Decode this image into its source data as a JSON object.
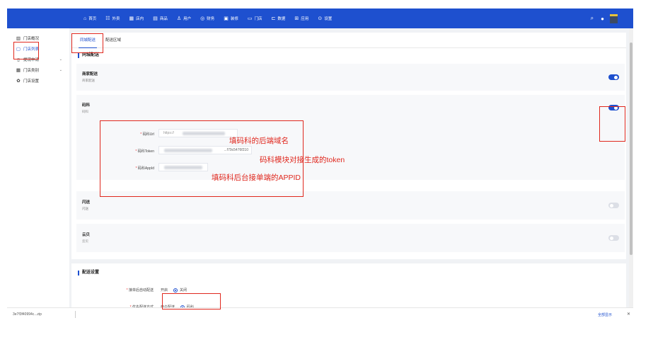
{
  "topnav": {
    "items": [
      {
        "icon": "home-icon",
        "glyph": "⌂",
        "label": "首页"
      },
      {
        "icon": "takeout-icon",
        "glyph": "☷",
        "label": "外卖"
      },
      {
        "icon": "dine-in-icon",
        "glyph": "▦",
        "label": "店内"
      },
      {
        "icon": "goods-icon",
        "glyph": "▤",
        "label": "商品"
      },
      {
        "icon": "user-icon",
        "glyph": "♙",
        "label": "用户"
      },
      {
        "icon": "finance-icon",
        "glyph": "◎",
        "label": "财务"
      },
      {
        "icon": "decorate-icon",
        "glyph": "▣",
        "label": "装修"
      },
      {
        "icon": "store-icon",
        "glyph": "▭",
        "label": "门店"
      },
      {
        "icon": "data-icon",
        "glyph": "⊏",
        "label": "数据"
      },
      {
        "icon": "apps-icon",
        "glyph": "⊞",
        "label": "应用"
      },
      {
        "icon": "settings-icon",
        "glyph": "⊙",
        "label": "设置"
      }
    ],
    "right_icons": [
      "search-icon",
      "notification-icon"
    ]
  },
  "sidebar": {
    "items": [
      {
        "icon": "chart-icon",
        "glyph": "▥",
        "label": "门店概况",
        "active": false,
        "chevron": false
      },
      {
        "icon": "store-list-icon",
        "glyph": "▢",
        "label": "门店列表",
        "active": true,
        "chevron": false
      },
      {
        "icon": "apply-icon",
        "glyph": "▯",
        "label": "提现申请",
        "active": false,
        "chevron": true
      },
      {
        "icon": "category-icon",
        "glyph": "▦",
        "label": "门店类别",
        "active": false,
        "chevron": true
      },
      {
        "icon": "gear-icon",
        "glyph": "✿",
        "label": "门店设置",
        "active": false,
        "chevron": false
      }
    ]
  },
  "tabs": [
    {
      "label": "同城配送",
      "active": true
    },
    {
      "label": "配送区域",
      "active": false
    }
  ],
  "section1_title": "同城配送",
  "rows": {
    "merchant": {
      "title": "商家配送",
      "sub": "商家配送",
      "enabled": true
    },
    "make": {
      "title": "码科",
      "sub": "码科",
      "enabled": true
    },
    "shansong": {
      "title": "闪送",
      "sub": "闪送",
      "enabled": false
    },
    "yunji": {
      "title": "云贝",
      "sub": "云贝",
      "enabled": false
    }
  },
  "form": {
    "url_label": "码科Url",
    "url_prefix": "https://",
    "token_label": "码科Token",
    "token_tail": "...f79c5476f210",
    "appid_label": "码科AppId"
  },
  "section2_title": "配送设置",
  "delivery": {
    "auto_label": "接单后自动配送",
    "auto_options": [
      {
        "label": "开启",
        "selected": false
      },
      {
        "label": "关闭",
        "selected": true
      }
    ],
    "priority_label": "优先配送方式",
    "priority_options": [
      {
        "label": "商户配送",
        "selected": false
      },
      {
        "label": "码科",
        "selected": true
      }
    ]
  },
  "bottombar": {
    "file": "3e7f3f40994c...zip",
    "more": "全部显示",
    "close": "✕"
  },
  "annotations": {
    "url_note": "填码科的后端域名",
    "token_note": "码科模块对接生成的token",
    "appid_note": "填码科后台接单端的APPID"
  }
}
